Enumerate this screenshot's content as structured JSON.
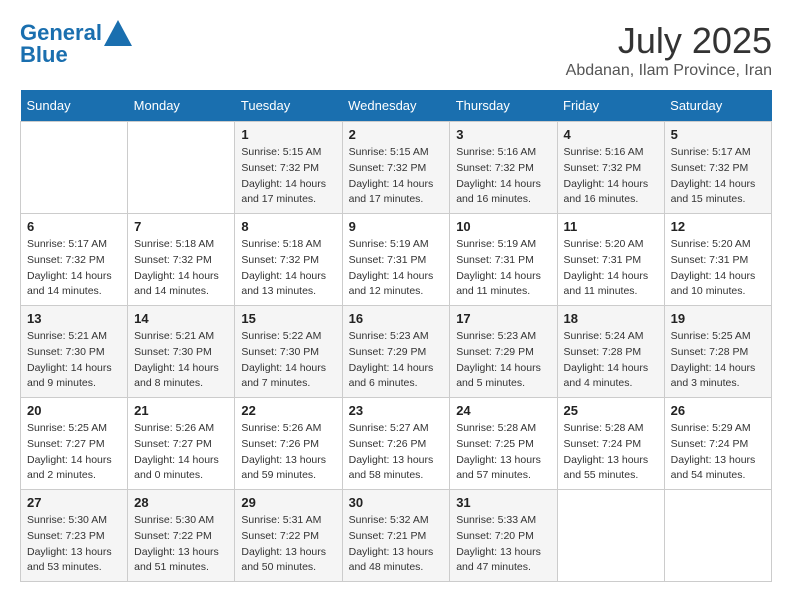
{
  "header": {
    "logo_line1": "General",
    "logo_line2": "Blue",
    "month": "July 2025",
    "location": "Abdanan, Ilam Province, Iran"
  },
  "days_of_week": [
    "Sunday",
    "Monday",
    "Tuesday",
    "Wednesday",
    "Thursday",
    "Friday",
    "Saturday"
  ],
  "weeks": [
    [
      {
        "day": "",
        "info": ""
      },
      {
        "day": "",
        "info": ""
      },
      {
        "day": "1",
        "info": "Sunrise: 5:15 AM\nSunset: 7:32 PM\nDaylight: 14 hours and 17 minutes."
      },
      {
        "day": "2",
        "info": "Sunrise: 5:15 AM\nSunset: 7:32 PM\nDaylight: 14 hours and 17 minutes."
      },
      {
        "day": "3",
        "info": "Sunrise: 5:16 AM\nSunset: 7:32 PM\nDaylight: 14 hours and 16 minutes."
      },
      {
        "day": "4",
        "info": "Sunrise: 5:16 AM\nSunset: 7:32 PM\nDaylight: 14 hours and 16 minutes."
      },
      {
        "day": "5",
        "info": "Sunrise: 5:17 AM\nSunset: 7:32 PM\nDaylight: 14 hours and 15 minutes."
      }
    ],
    [
      {
        "day": "6",
        "info": "Sunrise: 5:17 AM\nSunset: 7:32 PM\nDaylight: 14 hours and 14 minutes."
      },
      {
        "day": "7",
        "info": "Sunrise: 5:18 AM\nSunset: 7:32 PM\nDaylight: 14 hours and 14 minutes."
      },
      {
        "day": "8",
        "info": "Sunrise: 5:18 AM\nSunset: 7:32 PM\nDaylight: 14 hours and 13 minutes."
      },
      {
        "day": "9",
        "info": "Sunrise: 5:19 AM\nSunset: 7:31 PM\nDaylight: 14 hours and 12 minutes."
      },
      {
        "day": "10",
        "info": "Sunrise: 5:19 AM\nSunset: 7:31 PM\nDaylight: 14 hours and 11 minutes."
      },
      {
        "day": "11",
        "info": "Sunrise: 5:20 AM\nSunset: 7:31 PM\nDaylight: 14 hours and 11 minutes."
      },
      {
        "day": "12",
        "info": "Sunrise: 5:20 AM\nSunset: 7:31 PM\nDaylight: 14 hours and 10 minutes."
      }
    ],
    [
      {
        "day": "13",
        "info": "Sunrise: 5:21 AM\nSunset: 7:30 PM\nDaylight: 14 hours and 9 minutes."
      },
      {
        "day": "14",
        "info": "Sunrise: 5:21 AM\nSunset: 7:30 PM\nDaylight: 14 hours and 8 minutes."
      },
      {
        "day": "15",
        "info": "Sunrise: 5:22 AM\nSunset: 7:30 PM\nDaylight: 14 hours and 7 minutes."
      },
      {
        "day": "16",
        "info": "Sunrise: 5:23 AM\nSunset: 7:29 PM\nDaylight: 14 hours and 6 minutes."
      },
      {
        "day": "17",
        "info": "Sunrise: 5:23 AM\nSunset: 7:29 PM\nDaylight: 14 hours and 5 minutes."
      },
      {
        "day": "18",
        "info": "Sunrise: 5:24 AM\nSunset: 7:28 PM\nDaylight: 14 hours and 4 minutes."
      },
      {
        "day": "19",
        "info": "Sunrise: 5:25 AM\nSunset: 7:28 PM\nDaylight: 14 hours and 3 minutes."
      }
    ],
    [
      {
        "day": "20",
        "info": "Sunrise: 5:25 AM\nSunset: 7:27 PM\nDaylight: 14 hours and 2 minutes."
      },
      {
        "day": "21",
        "info": "Sunrise: 5:26 AM\nSunset: 7:27 PM\nDaylight: 14 hours and 0 minutes."
      },
      {
        "day": "22",
        "info": "Sunrise: 5:26 AM\nSunset: 7:26 PM\nDaylight: 13 hours and 59 minutes."
      },
      {
        "day": "23",
        "info": "Sunrise: 5:27 AM\nSunset: 7:26 PM\nDaylight: 13 hours and 58 minutes."
      },
      {
        "day": "24",
        "info": "Sunrise: 5:28 AM\nSunset: 7:25 PM\nDaylight: 13 hours and 57 minutes."
      },
      {
        "day": "25",
        "info": "Sunrise: 5:28 AM\nSunset: 7:24 PM\nDaylight: 13 hours and 55 minutes."
      },
      {
        "day": "26",
        "info": "Sunrise: 5:29 AM\nSunset: 7:24 PM\nDaylight: 13 hours and 54 minutes."
      }
    ],
    [
      {
        "day": "27",
        "info": "Sunrise: 5:30 AM\nSunset: 7:23 PM\nDaylight: 13 hours and 53 minutes."
      },
      {
        "day": "28",
        "info": "Sunrise: 5:30 AM\nSunset: 7:22 PM\nDaylight: 13 hours and 51 minutes."
      },
      {
        "day": "29",
        "info": "Sunrise: 5:31 AM\nSunset: 7:22 PM\nDaylight: 13 hours and 50 minutes."
      },
      {
        "day": "30",
        "info": "Sunrise: 5:32 AM\nSunset: 7:21 PM\nDaylight: 13 hours and 48 minutes."
      },
      {
        "day": "31",
        "info": "Sunrise: 5:33 AM\nSunset: 7:20 PM\nDaylight: 13 hours and 47 minutes."
      },
      {
        "day": "",
        "info": ""
      },
      {
        "day": "",
        "info": ""
      }
    ]
  ]
}
